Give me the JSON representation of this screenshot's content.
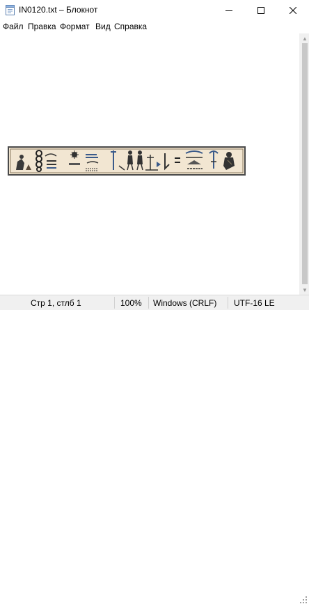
{
  "window": {
    "title": "IN0120.txt – Блокнот"
  },
  "menu": {
    "file": "Файл",
    "edit": "Правка",
    "format": "Формат",
    "view": "Вид",
    "help": "Справка"
  },
  "document": {
    "content_icon": "egyptian-hieroglyph-cartouche-icon"
  },
  "status": {
    "position": "Стр 1, стлб 1",
    "zoom": "100%",
    "line_endings": "Windows (CRLF)",
    "encoding": "UTF-16 LE"
  },
  "colors": {
    "statusbar": "#f0f0f0",
    "cartouche_bg": "#f2e6d2",
    "cartouche_border": "#4a4a4a"
  }
}
